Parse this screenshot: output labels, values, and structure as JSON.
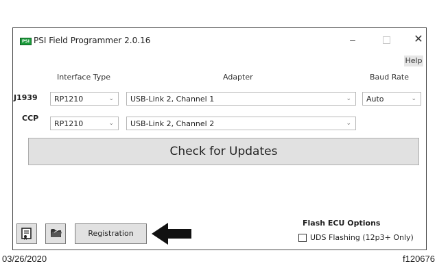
{
  "window": {
    "title": "PSI Field Programmer 2.0.16",
    "app_icon_text": "PSI",
    "minimize_glyph": "–",
    "close_glyph": "✕",
    "help_label": "Help"
  },
  "headers": {
    "interface_type": "Interface Type",
    "adapter": "Adapter",
    "baud_rate": "Baud Rate"
  },
  "rows": [
    {
      "label": "J1939",
      "interface": "RP1210",
      "adapter": "USB-Link 2, Channel 1",
      "baud": "Auto"
    },
    {
      "label": "CCP",
      "interface": "RP1210",
      "adapter": "USB-Link 2, Channel 2"
    }
  ],
  "chevron_glyph": "⌄",
  "check_updates_label": "Check for Updates",
  "bottom": {
    "registration_label": "Registration",
    "flash_title": "Flash ECU Options",
    "uds_label": "UDS Flashing (12p3+ Only)",
    "uds_checked": false
  },
  "footer": {
    "date": "03/26/2020",
    "figure_id": "f120676"
  },
  "icons": [
    "certificate-icon",
    "folder-icon",
    "pointer-arrow-icon"
  ]
}
